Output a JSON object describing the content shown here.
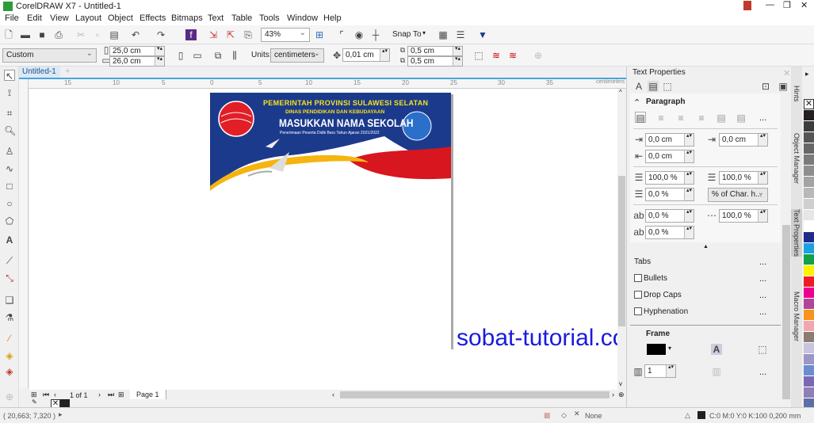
{
  "app": {
    "title": "CorelDRAW X7 - Untitled-1"
  },
  "menu": [
    "File",
    "Edit",
    "View",
    "Layout",
    "Object",
    "Effects",
    "Bitmaps",
    "Text",
    "Table",
    "Tools",
    "Window",
    "Help"
  ],
  "toolbar": {
    "zoom": "43%",
    "snap_to": "Snap To"
  },
  "property_bar": {
    "page_size": "Custom",
    "width": "25,0 cm",
    "height": "26,0 cm",
    "units_label": "Units:",
    "units": "centimeters",
    "nudge": "0,01 cm",
    "dup_x": "0,5 cm",
    "dup_y": "0,5 cm"
  },
  "document": {
    "tab": "Untitled-1",
    "ruler_unit": "centimeters",
    "ruler_h": [
      "15",
      "10",
      "5",
      "0",
      "5",
      "10",
      "15",
      "20",
      "25",
      "30",
      "35"
    ],
    "banner": {
      "line1": "PEMERINTAH PROVINSI SULAWESI SELATAN",
      "line2": "DINAS PENDIDIKAN DAN KEBUDAYAAN",
      "line3": "MASUKKAN NAMA SEKOLAH",
      "line4": "Penerimaan Peserta Didik Baru Tahun Ajaran 2021/2022"
    },
    "watermark": "sobat-tutorial.com"
  },
  "page_nav": {
    "count": "1 of 1",
    "page": "Page 1"
  },
  "docker": {
    "title": "Text Properties",
    "section": "Paragraph",
    "left_indent": "0,0 cm",
    "first_indent": "0,0 cm",
    "right_indent": "0,0 cm",
    "line_spacing": "100,0 %",
    "char_spacing_pct": "100,0 %",
    "before_para": "0,0 %",
    "spacing_unit": "% of Char. h...",
    "word_spacing": "0,0 %",
    "lang_spacing": "100,0 %",
    "char_spacing": "0,0 %",
    "tabs": "Tabs",
    "bullets": "Bullets",
    "drop_caps": "Drop Caps",
    "hyphenation": "Hyphenation",
    "frame": "Frame",
    "columns": "1",
    "more": "..."
  },
  "docker_tabs": [
    "Hints",
    "Object Manager",
    "Text Properties",
    "Macro Manager"
  ],
  "palette": [
    "#231f20",
    "#3d3d3d",
    "#555555",
    "#666666",
    "#7a7a7a",
    "#8e8e8e",
    "#a3a3a3",
    "#b8b8b8",
    "#cfcfcf",
    "#e6e6e6",
    "#ffffff",
    "#1f2a8a",
    "#1ba1e2",
    "#12a04a",
    "#fff200",
    "#ed1c24",
    "#ec008c",
    "#b2459b",
    "#f7941d",
    "#f4a6b0",
    "#8c7b70",
    "#c9c3e2",
    "#9c95c9",
    "#6c8cd0",
    "#7b68b5",
    "#8e7fb7",
    "#5b6ea8"
  ],
  "status": {
    "coords": "( 20,663; 7,320 )",
    "fill": "None",
    "outline": "C:0 M:0 Y:0 K:100  0,200 mm"
  },
  "colors": {
    "banner_blue": "#1c3a8c",
    "banner_red": "#d7161f",
    "banner_yellow": "#f5b40f",
    "watermark": "#1a1adc",
    "accent": "#4aa3df"
  }
}
